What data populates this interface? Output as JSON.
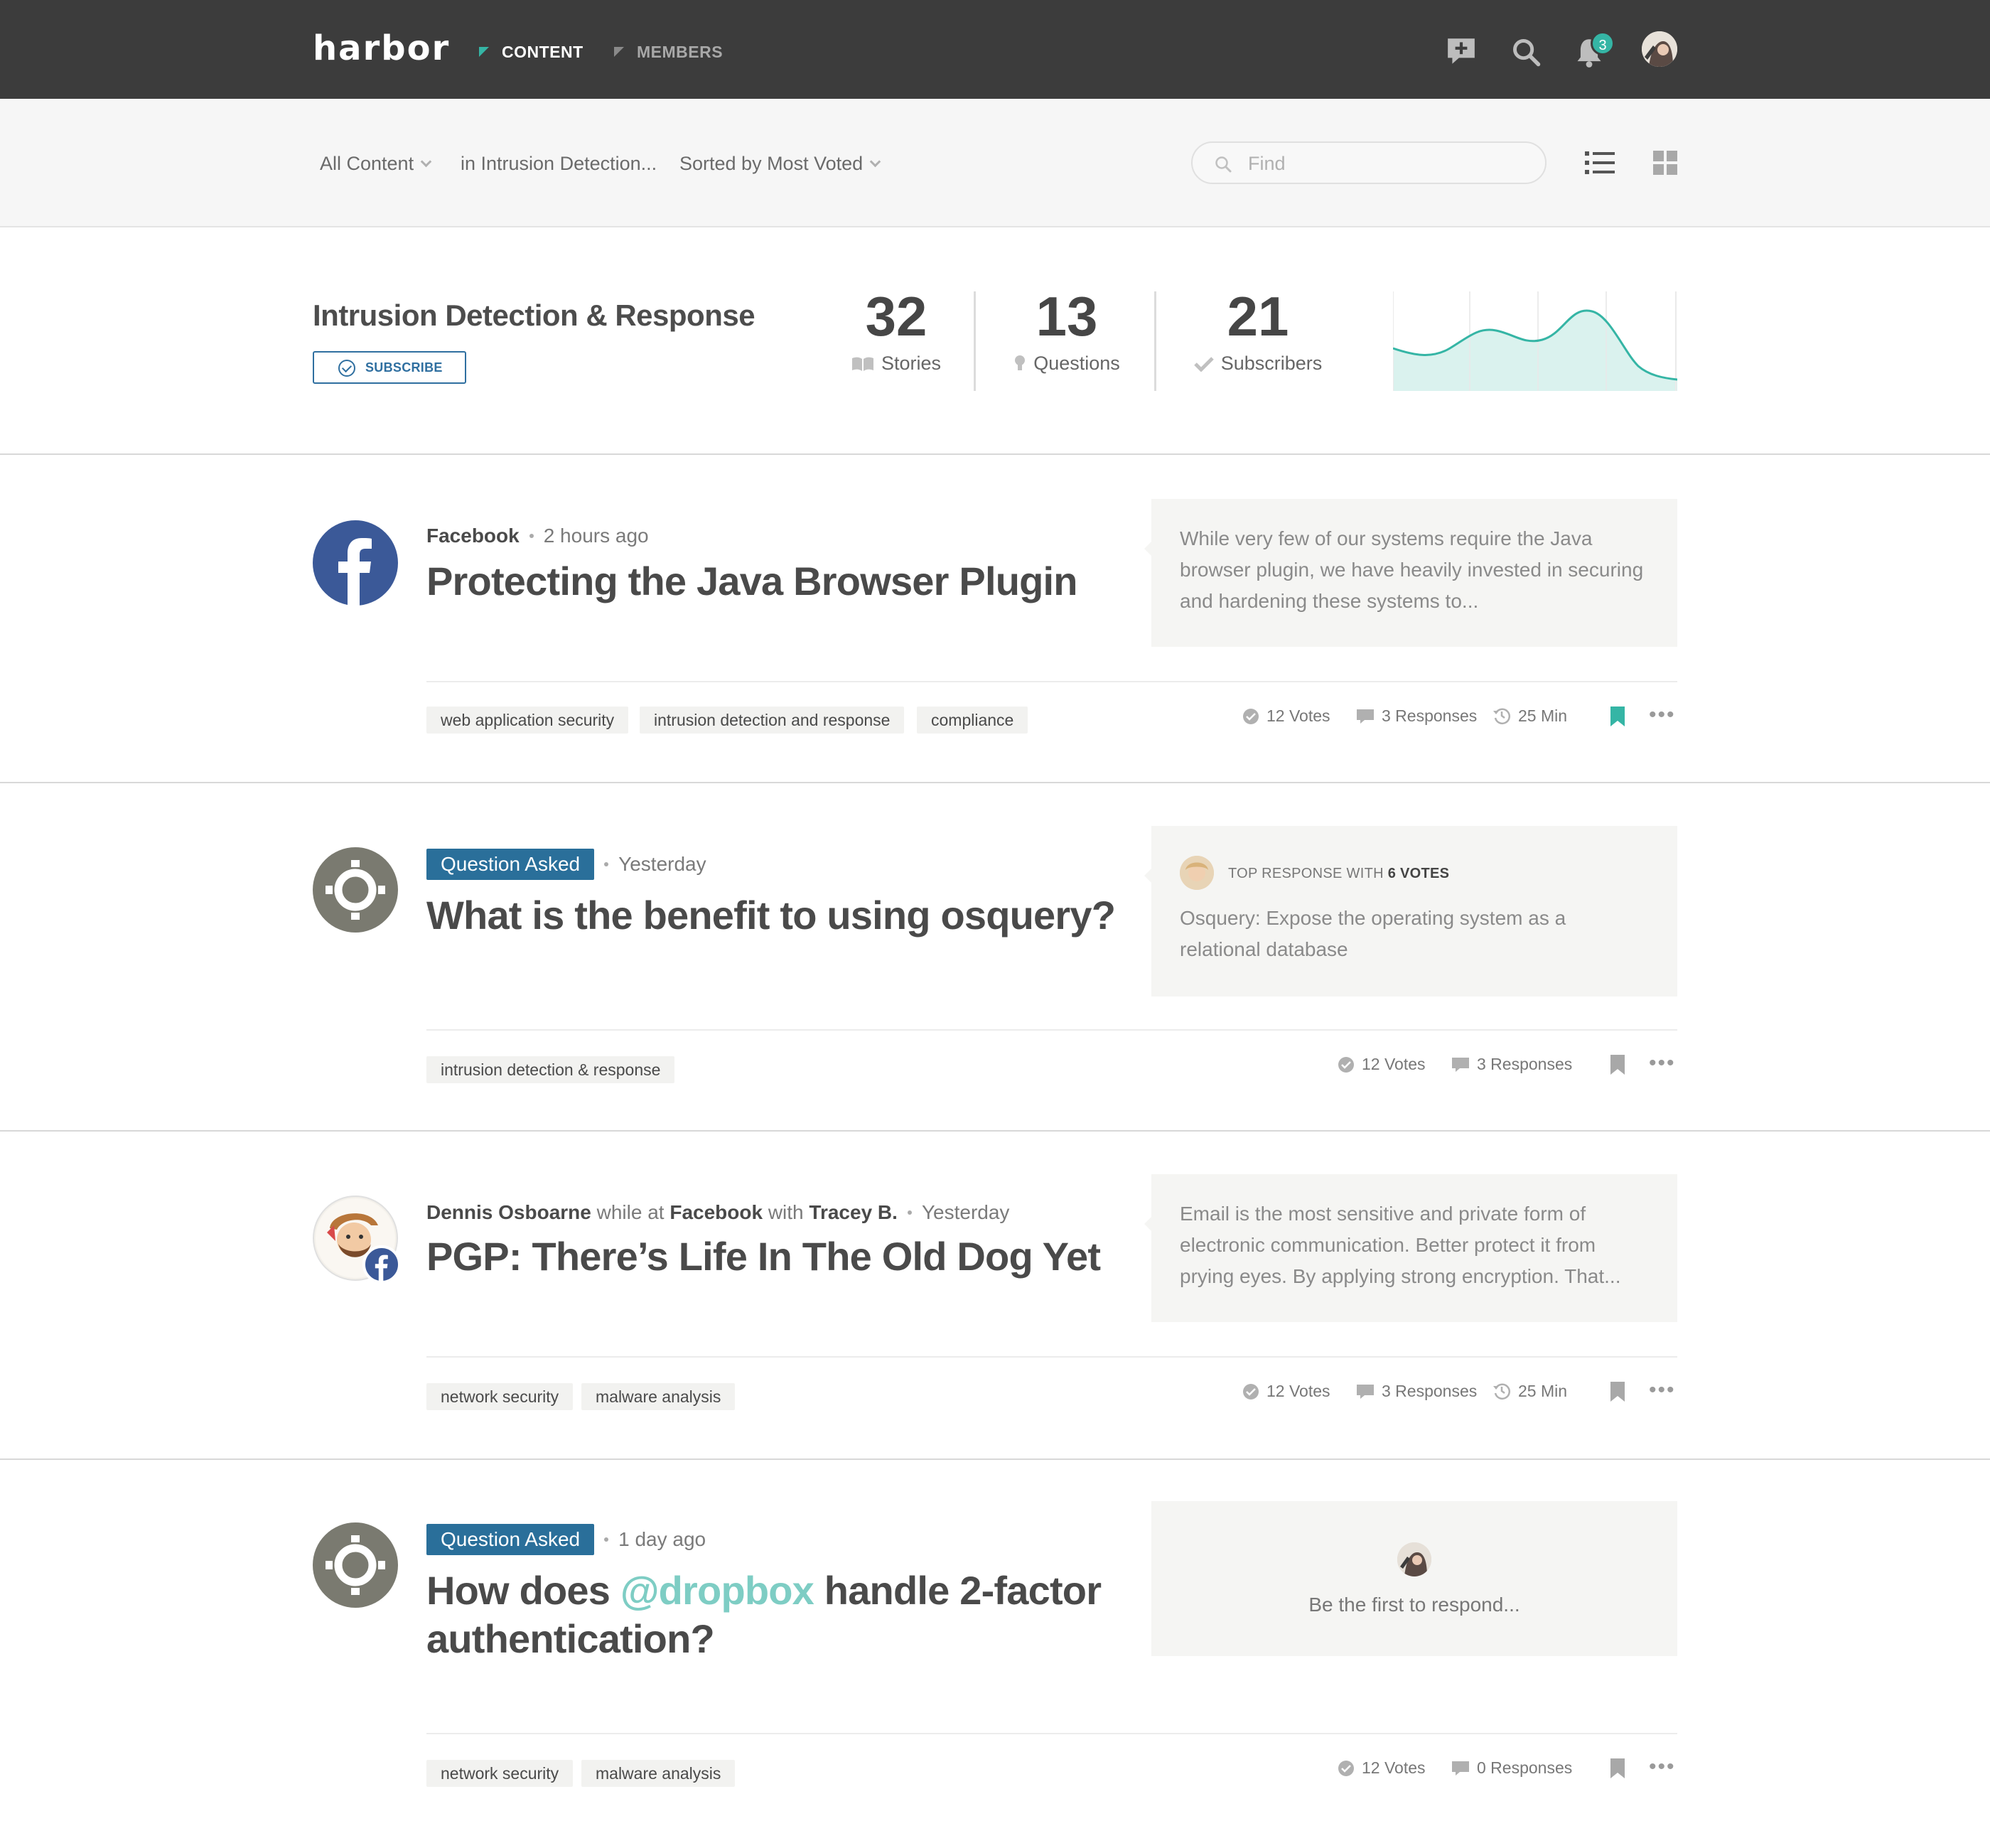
{
  "nav": {
    "logo": "harbor",
    "tabs": [
      {
        "label": "CONTENT",
        "active": true
      },
      {
        "label": "MEMBERS",
        "active": false
      }
    ],
    "notification_count": "3",
    "accent_color": "#35b5a5"
  },
  "filters": {
    "content_type": "All Content",
    "scope": "in Intrusion Detection...",
    "sort": "Sorted by Most Voted",
    "search_placeholder": "Find"
  },
  "topic": {
    "title": "Intrusion Detection & Response",
    "subscribe_label": "SUBSCRIBE",
    "stats": [
      {
        "value": "32",
        "label": "Stories"
      },
      {
        "value": "13",
        "label": "Questions"
      },
      {
        "value": "21",
        "label": "Subscribers"
      }
    ]
  },
  "feed": [
    {
      "author": "Facebook",
      "time": "2 hours ago",
      "title": "Protecting the Java Browser Plugin",
      "excerpt": "While very few of our systems require the Java browser plugin, we have heavily invested in securing and hardening these systems to...",
      "tags": [
        "web application security",
        "intrusion detection and response",
        "compliance"
      ],
      "votes": "12 Votes",
      "responses": "3 Responses",
      "read_time": "25 Min",
      "bookmarked": true
    },
    {
      "badge": "Question Asked",
      "time": "Yesterday",
      "title": "What is the benefit to using osquery?",
      "top_response_prefix": "TOP RESPONSE WITH",
      "top_response_votes": "6 VOTES",
      "top_response_text": "Osquery: Expose the operating system as a relational database",
      "tags": [
        "intrusion detection & response"
      ],
      "votes": "12 Votes",
      "responses": "3 Responses",
      "bookmarked": false
    },
    {
      "author": "Dennis Osboarne",
      "while_at": "while at",
      "company": "Facebook",
      "with": "with",
      "coauthor": "Tracey B.",
      "time": "Yesterday",
      "title": "PGP: There’s Life In The Old Dog Yet",
      "excerpt": "Email is the most sensitive and private form of electronic communication. Better protect it from prying eyes. By applying strong encryption. That...",
      "tags": [
        "network security",
        "malware analysis"
      ],
      "votes": "12 Votes",
      "responses": "3 Responses",
      "read_time": "25 Min",
      "bookmarked": false
    },
    {
      "badge": "Question Asked",
      "time": "1 day ago",
      "title_prefix": "How does",
      "mention": "@dropbox",
      "title_suffix": "handle 2-factor authentication?",
      "respond_prompt": "Be the first to respond...",
      "tags": [
        "network security",
        "malware analysis"
      ],
      "votes": "12 Votes",
      "responses": "0 Responses",
      "bookmarked": false
    }
  ]
}
